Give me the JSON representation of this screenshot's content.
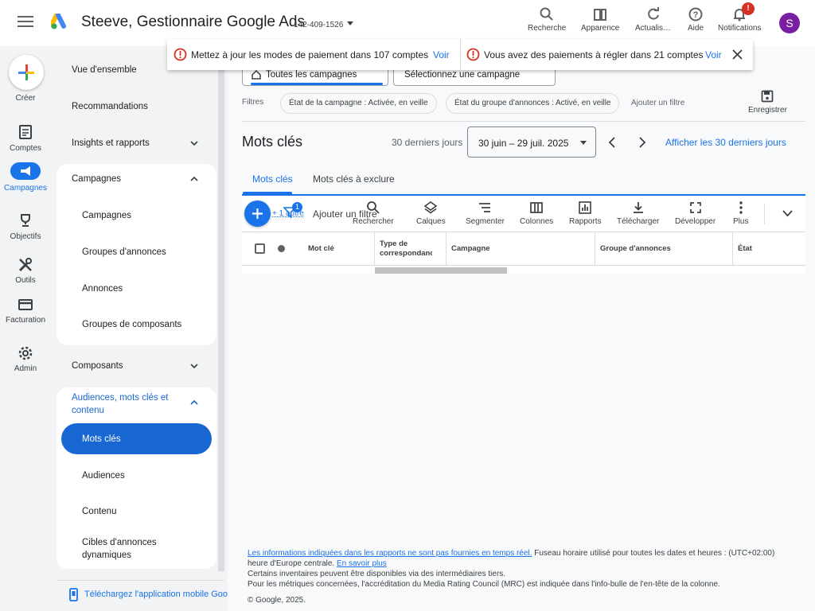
{
  "header": {
    "title": "Steeve, Gestionnaire Google Ads",
    "account_id": "142-409-1526",
    "tools": [
      {
        "label": "Recherche",
        "icon": "search-icon"
      },
      {
        "label": "Apparence",
        "icon": "appearance-icon"
      },
      {
        "label": "Actualis…",
        "icon": "refresh-icon"
      },
      {
        "label": "Aide",
        "icon": "help-icon"
      },
      {
        "label": "Notifications",
        "icon": "bell-icon"
      }
    ],
    "notification_badge": "!",
    "avatar_letter": "S"
  },
  "notices": [
    {
      "text": "Mettez à jour les modes de paiement dans 107 comptes",
      "link": "Voir"
    },
    {
      "text": "Vous avez des paiements à régler dans 21 comptes",
      "link": "Voir"
    }
  ],
  "rail": {
    "create": "Créer",
    "items": [
      "Comptes",
      "Campagnes",
      "Objectifs",
      "Outils",
      "Facturation",
      "Admin"
    ]
  },
  "nav": {
    "overview": "Vue d'ensemble",
    "recommendations": "Recommandations",
    "insights": "Insights et rapports",
    "campaigns_group": "Campagnes",
    "campaigns": "Campagnes",
    "ad_groups": "Groupes d'annonces",
    "ads": "Annonces",
    "asset_groups": "Groupes de composants",
    "assets": "Composants",
    "audiences_group": "Audiences, mots clés et contenu",
    "keywords": "Mots clés",
    "audiences": "Audiences",
    "content": "Contenu",
    "dynamic_targets": "Cibles d'annonces dynamiques",
    "app_link": "Téléchargez l'application mobile Google"
  },
  "selectors": {
    "all_campaigns": "Toutes les campagnes",
    "select_campaign": "Sélectionnez une campagne"
  },
  "filters": {
    "label": "Filtres",
    "chips": [
      "État de la campagne : Activée, en veille",
      "État du groupe d'annonces : Activé, en veille"
    ],
    "add": "Ajouter un filtre",
    "save": "Enregistrer"
  },
  "page": {
    "title": "Mots clés",
    "date_label": "30 derniers jours",
    "date_range": "30 juin – 29 juil. 2025",
    "show_last_30": "Afficher les 30 derniers jours"
  },
  "tabs": [
    "Mots clés",
    "Mots clés à exclure"
  ],
  "toolbar": {
    "filter_badge": "1",
    "one_other": "+ 1 autre",
    "add_filter": "Ajouter un filtre",
    "tools": [
      {
        "label": "Rechercher",
        "icon": "search-icon"
      },
      {
        "label": "Calques",
        "icon": "layers-icon"
      },
      {
        "label": "Segmenter",
        "icon": "segment-icon"
      },
      {
        "label": "Colonnes",
        "icon": "columns-icon"
      },
      {
        "label": "Rapports",
        "icon": "reports-icon"
      },
      {
        "label": "Télécharger",
        "icon": "download-icon"
      },
      {
        "label": "Développer",
        "icon": "expand-icon"
      },
      {
        "label": "Plus",
        "icon": "more-icon"
      }
    ]
  },
  "table": {
    "columns": [
      "Mot clé",
      "Type de correspondance",
      "Campagne",
      "Groupe d'annonces",
      "État"
    ]
  },
  "footer": {
    "line1_link": "Les informations indiquées dans les rapports ne sont pas fournies en temps réel.",
    "line1_text": " Fuseau horaire utilisé pour toutes les dates et heures : (UTC+02:00)",
    "line2_text": "heure d'Europe centrale. ",
    "line2_link": "En savoir plus",
    "line3": "Certains inventaires peuvent être disponibles via des intermédiaires tiers.",
    "line4": "Pour les métriques concernées, l'accréditation du Media Rating Council (MRC) est indiquée dans l'info-bulle de l'en-tête de la colonne.",
    "copyright": "© Google, 2025."
  }
}
